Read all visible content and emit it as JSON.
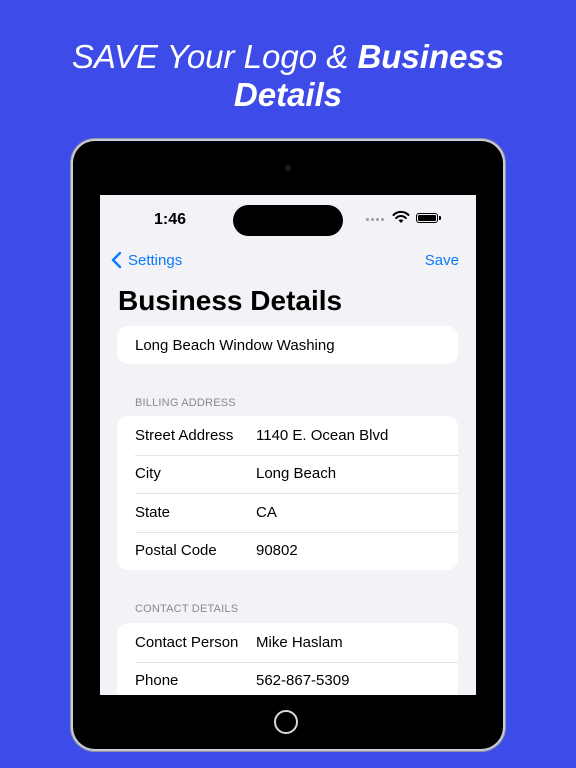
{
  "headline": {
    "line1_light": "SAVE Your Logo & ",
    "line1_bold": "Business",
    "line2_bold": "Details"
  },
  "status_bar": {
    "time": "1:46"
  },
  "nav": {
    "back_label": "Settings",
    "save_label": "Save"
  },
  "page_title": "Business Details",
  "business_name": "Long Beach Window Washing",
  "billing": {
    "header": "BILLING ADDRESS",
    "rows": [
      {
        "label": "Street Address",
        "value": "1140 E. Ocean Blvd"
      },
      {
        "label": "City",
        "value": "Long Beach"
      },
      {
        "label": "State",
        "value": "CA"
      },
      {
        "label": "Postal Code",
        "value": "90802"
      }
    ]
  },
  "contact": {
    "header": "CONTACT DETAILS",
    "rows": [
      {
        "label": "Contact Person",
        "value": "Mike Haslam"
      },
      {
        "label": "Phone",
        "value": "562-867-5309"
      }
    ]
  },
  "colors": {
    "background": "#3d4ce8",
    "accent": "#0a7aff",
    "screen": "#f2f2f7"
  }
}
